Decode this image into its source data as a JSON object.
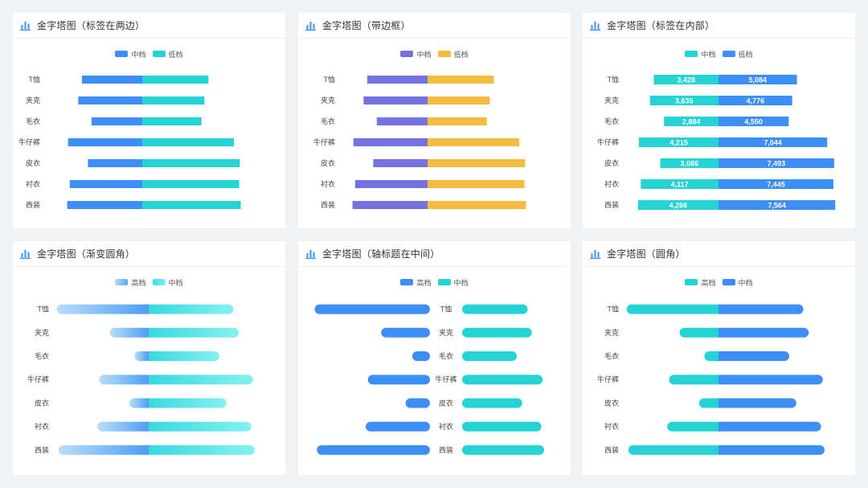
{
  "colors": {
    "blue": "#3d8ef5",
    "teal": "#26d3d4",
    "purple": "#7372de",
    "yellow": "#f5bc42"
  },
  "chart_data": [
    {
      "type": "bar",
      "title": "金字塔图（标签在两边）",
      "categories": [
        "T恤",
        "夹克",
        "毛衣",
        "牛仔裤",
        "皮衣",
        "衬衣",
        "西装"
      ],
      "series": [
        {
          "name": "中档",
          "values": [
            3428,
            3635,
            2884,
            4215,
            3086,
            4117,
            4266
          ],
          "color": "#3d8ef5"
        },
        {
          "name": "低档",
          "values": [
            5084,
            4776,
            4550,
            7044,
            7493,
            7445,
            7564
          ],
          "color": "#26d3d4"
        }
      ]
    },
    {
      "type": "bar",
      "title": "金字塔图（带边框）",
      "categories": [
        "T恤",
        "夹克",
        "毛衣",
        "牛仔裤",
        "皮衣",
        "衬衣",
        "西装"
      ],
      "series": [
        {
          "name": "中档",
          "values": [
            3428,
            3635,
            2884,
            4215,
            3086,
            4117,
            4266
          ],
          "color": "#7372de"
        },
        {
          "name": "低档",
          "values": [
            5084,
            4776,
            4550,
            7044,
            7493,
            7445,
            7564
          ],
          "color": "#f5bc42"
        }
      ]
    },
    {
      "type": "bar",
      "title": "金字塔图（标签在内部）",
      "categories": [
        "T恤",
        "夹克",
        "毛衣",
        "牛仔裤",
        "皮衣",
        "衬衣",
        "西装"
      ],
      "series": [
        {
          "name": "中档",
          "values": [
            3428,
            3635,
            2884,
            4215,
            3086,
            4117,
            4266
          ],
          "color": "#26d3d4",
          "labels": [
            "3,428",
            "3,635",
            "2,884",
            "4,215",
            "3,086",
            "4,117",
            "4,266"
          ]
        },
        {
          "name": "低档",
          "values": [
            5084,
            4776,
            4550,
            7044,
            7493,
            7445,
            7564
          ],
          "color": "#3d8ef5",
          "labels": [
            "5,084",
            "4,776",
            "4,550",
            "7,044",
            "7,493",
            "7,445",
            "7,564"
          ]
        }
      ]
    },
    {
      "type": "bar",
      "title": "金字塔图（渐变圆角）",
      "categories": [
        "T恤",
        "夹克",
        "毛衣",
        "牛仔裤",
        "皮衣",
        "衬衣",
        "西装"
      ],
      "series": [
        {
          "name": "高档",
          "values": [
            5200,
            2200,
            800,
            2800,
            1100,
            2900,
            5100
          ],
          "color": "#7fbff7"
        },
        {
          "name": "中档",
          "values": [
            4800,
            5100,
            4000,
            5900,
            4400,
            5800,
            6000
          ],
          "color": "#4ae0e6"
        }
      ]
    },
    {
      "type": "bar",
      "title": "金字塔图（轴标题在中间）",
      "categories": [
        "T恤",
        "夹克",
        "毛衣",
        "牛仔裤",
        "皮衣",
        "衬衣",
        "西装"
      ],
      "series": [
        {
          "name": "高档",
          "values": [
            5200,
            2200,
            800,
            2800,
            1100,
            2900,
            5100
          ],
          "color": "#3d8ef5"
        },
        {
          "name": "中档",
          "values": [
            4800,
            5100,
            4000,
            5900,
            4400,
            5800,
            6000
          ],
          "color": "#26d3d4"
        }
      ]
    },
    {
      "type": "bar",
      "title": "金字塔图（圆角）",
      "categories": [
        "T恤",
        "夹克",
        "毛衣",
        "牛仔裤",
        "皮衣",
        "衬衣",
        "西装"
      ],
      "series": [
        {
          "name": "高档",
          "values": [
            5200,
            2200,
            800,
            2800,
            1100,
            2900,
            5100
          ],
          "color": "#26d3d4"
        },
        {
          "name": "中档",
          "values": [
            4800,
            5100,
            4000,
            5900,
            4400,
            5800,
            6000
          ],
          "color": "#3d8ef5"
        }
      ]
    }
  ]
}
